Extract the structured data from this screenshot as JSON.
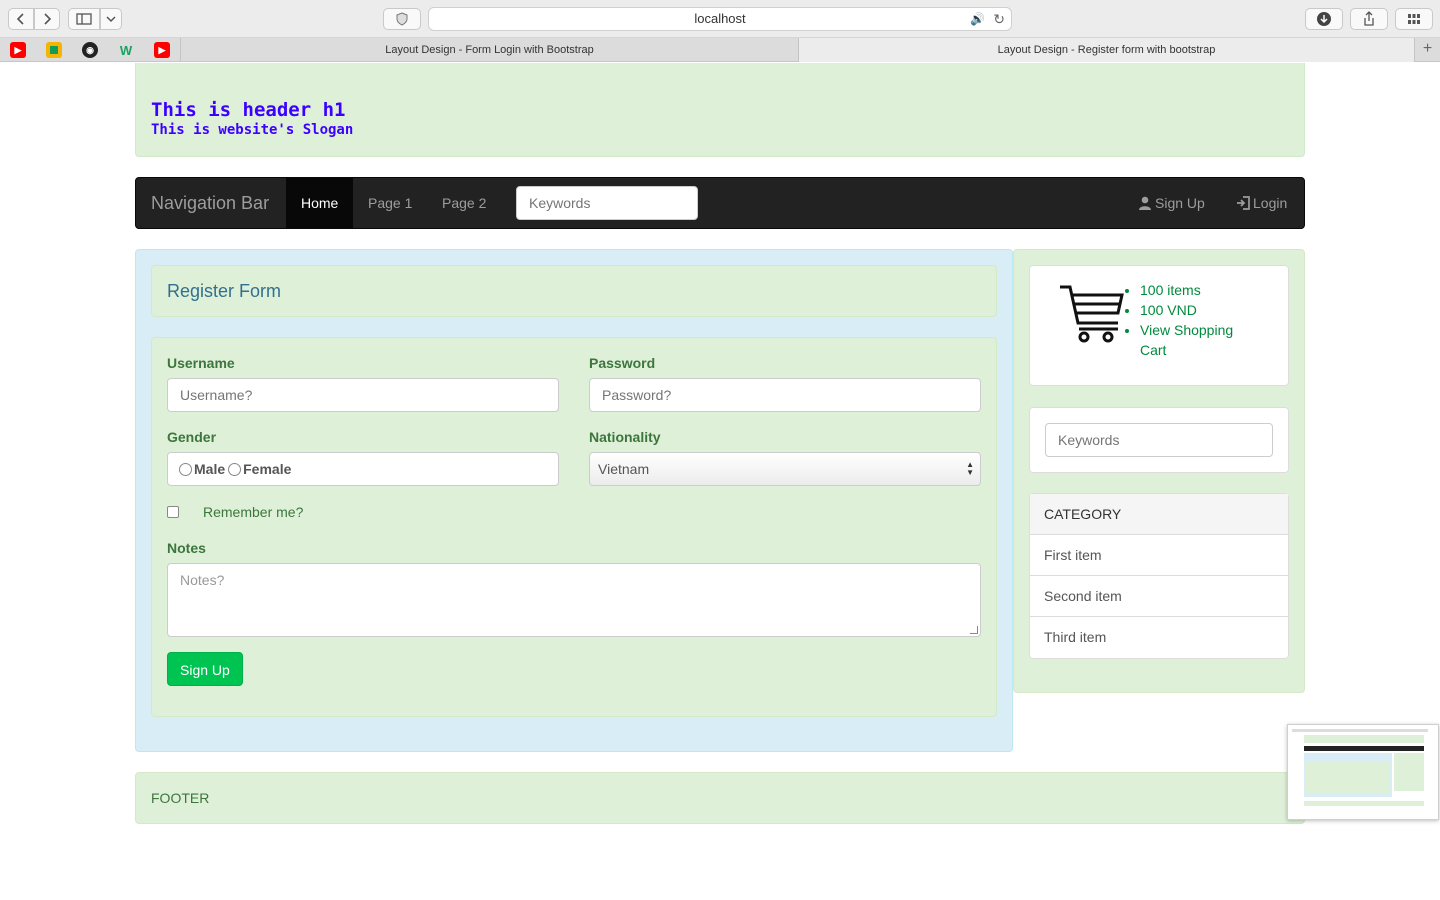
{
  "browser": {
    "url": "localhost",
    "tabs": [
      {
        "title": "Layout Design - Form Login with Bootstrap"
      },
      {
        "title": "Layout Design - Register form with bootstrap"
      }
    ],
    "favorites": [
      "youtube-icon",
      "google-drive-icon",
      "github-icon",
      "w-icon",
      "youtube-icon"
    ]
  },
  "header": {
    "title": "This is header h1",
    "slogan": "This is website's Slogan"
  },
  "navbar": {
    "brand": "Navigation Bar",
    "links": [
      {
        "label": "Home"
      },
      {
        "label": "Page 1"
      },
      {
        "label": "Page 2"
      }
    ],
    "search_placeholder": "Keywords",
    "signup_label": "Sign Up",
    "login_label": "Login"
  },
  "form": {
    "title": "Register Form",
    "username_label": "Username",
    "username_placeholder": "Username?",
    "password_label": "Password",
    "password_placeholder": "Password?",
    "gender_label": "Gender",
    "gender_options": [
      "Male",
      "Female"
    ],
    "nationality_label": "Nationality",
    "nationality_value": "Vietnam",
    "remember_label": "Remember me?",
    "notes_label": "Notes",
    "notes_placeholder": "Notes?",
    "submit_label": "Sign Up"
  },
  "sidebar": {
    "cart_items": [
      "100 items",
      "100 VND",
      "View Shopping Cart"
    ],
    "search_placeholder": "Keywords",
    "category_title": "CATEGORY",
    "categories": [
      "First item",
      "Second item",
      "Third item"
    ]
  },
  "footer": {
    "text": "FOOTER"
  }
}
